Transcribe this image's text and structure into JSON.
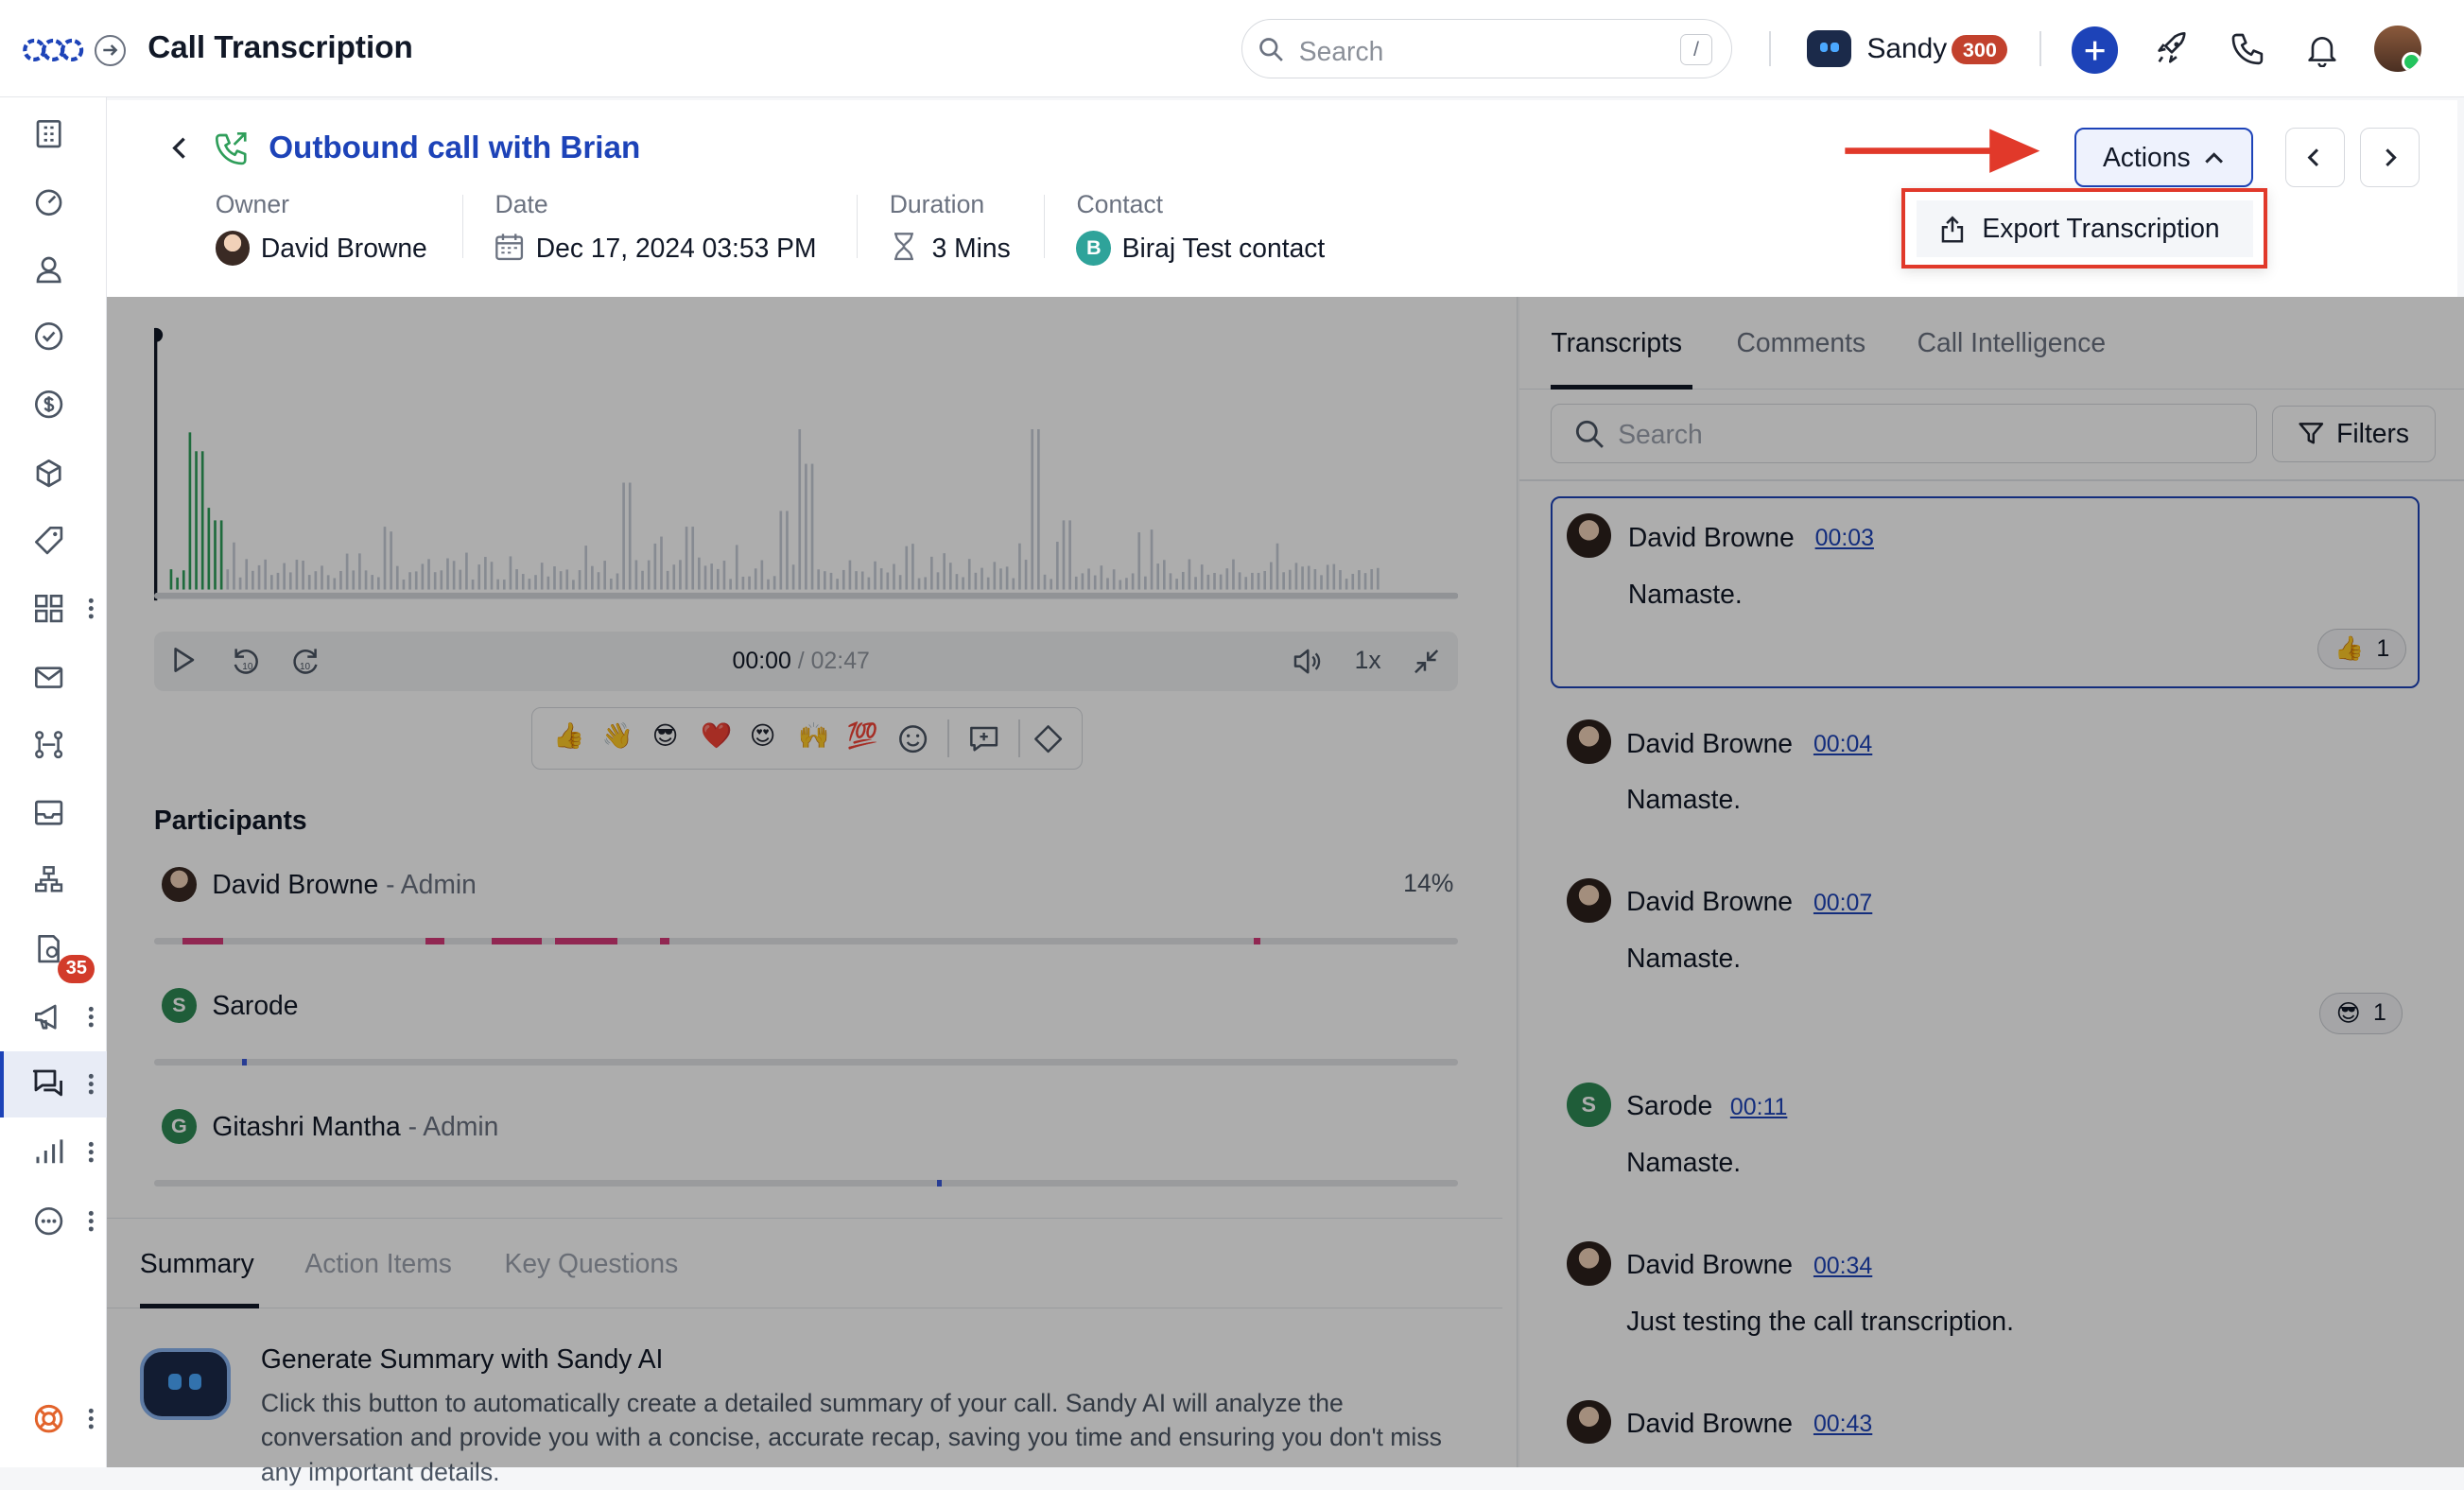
{
  "app": {
    "title": "Call Transcription"
  },
  "topbar": {
    "search_placeholder": "Search",
    "search_shortcut": "/",
    "user_name": "Sandy",
    "credits": "300"
  },
  "sidebar": {
    "badge_count": "35"
  },
  "call": {
    "title": "Outbound call with Brian",
    "owner_label": "Owner",
    "owner": "David Browne",
    "date_label": "Date",
    "date": "Dec 17, 2024 03:53 PM",
    "duration_label": "Duration",
    "duration": "3 Mins",
    "contact_label": "Contact",
    "contact_initial": "B",
    "contact": "Biraj Test contact"
  },
  "actions": {
    "label": "Actions",
    "menu_item": "Export Transcription"
  },
  "player": {
    "current": "00:00",
    "separator": " / ",
    "total": "02:47",
    "speed": "1x"
  },
  "reactions": [
    "👍",
    "👋",
    "😎",
    "❤️",
    "😍",
    "🙌",
    "💯"
  ],
  "participants": {
    "title": "Participants",
    "list": [
      {
        "name": "David Browne",
        "role": " - Admin",
        "pct": "14%"
      },
      {
        "name": "Sarode",
        "initial": "S",
        "role": ""
      },
      {
        "name": "Gitashri Mantha",
        "initial": "G",
        "role": " - Admin"
      }
    ]
  },
  "bottom_tabs": [
    "Summary",
    "Action Items",
    "Key Questions"
  ],
  "summary": {
    "title": "Generate Summary with Sandy AI",
    "description": "Click this button to automatically create a detailed summary of your call. Sandy AI will analyze the conversation and provide you with a concise, accurate recap, saving you time and ensuring you don't miss any important details."
  },
  "right_tabs": [
    "Transcripts",
    "Comments",
    "Call Intelligence"
  ],
  "transcript_search_placeholder": "Search",
  "filters_label": "Filters",
  "transcripts": [
    {
      "speaker": "David Browne",
      "time": "00:03",
      "text": "Namaste.",
      "reaction": "👍",
      "reaction_count": "1"
    },
    {
      "speaker": "David Browne",
      "time": "00:04",
      "text": "Namaste."
    },
    {
      "speaker": "David Browne",
      "time": "00:07",
      "text": "Namaste.",
      "reaction": "😎",
      "reaction_count": "1"
    },
    {
      "speaker": "Sarode",
      "initial": "S",
      "time": "00:11",
      "text": "Namaste."
    },
    {
      "speaker": "David Browne",
      "time": "00:34",
      "text": "Just testing the call transcription."
    },
    {
      "speaker": "David Browne",
      "time": "00:43",
      "text": ""
    }
  ],
  "colors": {
    "brand": "#1d43b8",
    "highlight": "#e1392a",
    "speaker_david": "#d63a7a",
    "speaker_other": "#3b5bdb"
  }
}
